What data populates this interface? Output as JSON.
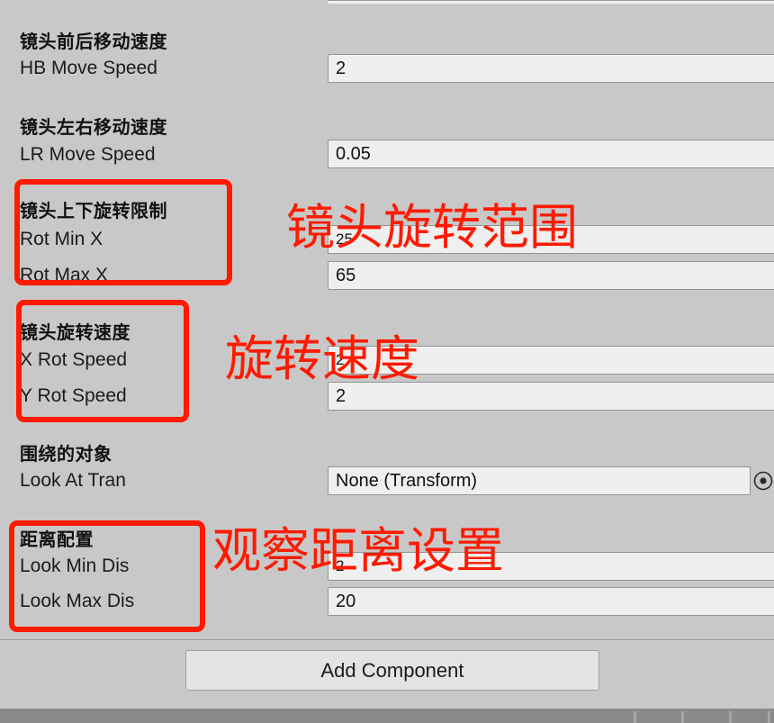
{
  "panel": {
    "type": "unity-inspector",
    "background_color": "#c8c8c8",
    "field_background_color": "#efefef",
    "annotation_color": "#ff1a00"
  },
  "properties": [
    {
      "cn_label": "镜头前后移动速度",
      "en_label": "HB Move Speed",
      "value": "2",
      "field_type": "number"
    },
    {
      "cn_label": "镜头左右移动速度",
      "en_label": "LR Move Speed",
      "value": "0.05",
      "field_type": "number"
    },
    {
      "cn_label": "镜头上下旋转限制",
      "en_label": "Rot Min X",
      "value": "25",
      "field_type": "number"
    },
    {
      "cn_label": "",
      "en_label": "Rot Max X",
      "value": "65",
      "field_type": "number"
    },
    {
      "cn_label": "镜头旋转速度",
      "en_label": "X Rot Speed",
      "value": "2",
      "field_type": "number"
    },
    {
      "cn_label": "",
      "en_label": "Y Rot Speed",
      "value": "2",
      "field_type": "number"
    },
    {
      "cn_label": "围绕的对象",
      "en_label": "Look At Tran",
      "value": "None (Transform)",
      "field_type": "object"
    },
    {
      "cn_label": "距离配置",
      "en_label": "Look Min Dis",
      "value": "2",
      "field_type": "number"
    },
    {
      "cn_label": "",
      "en_label": "Look Max Dis",
      "value": "20",
      "field_type": "number"
    }
  ],
  "add_component": {
    "label": "Add Component"
  },
  "annotations": [
    {
      "text": "镜头旋转范围",
      "target": "rotation-limit"
    },
    {
      "text": "旋转速度",
      "target": "rotation-speed"
    },
    {
      "text": "观察距离设置",
      "target": "look-distance"
    }
  ]
}
